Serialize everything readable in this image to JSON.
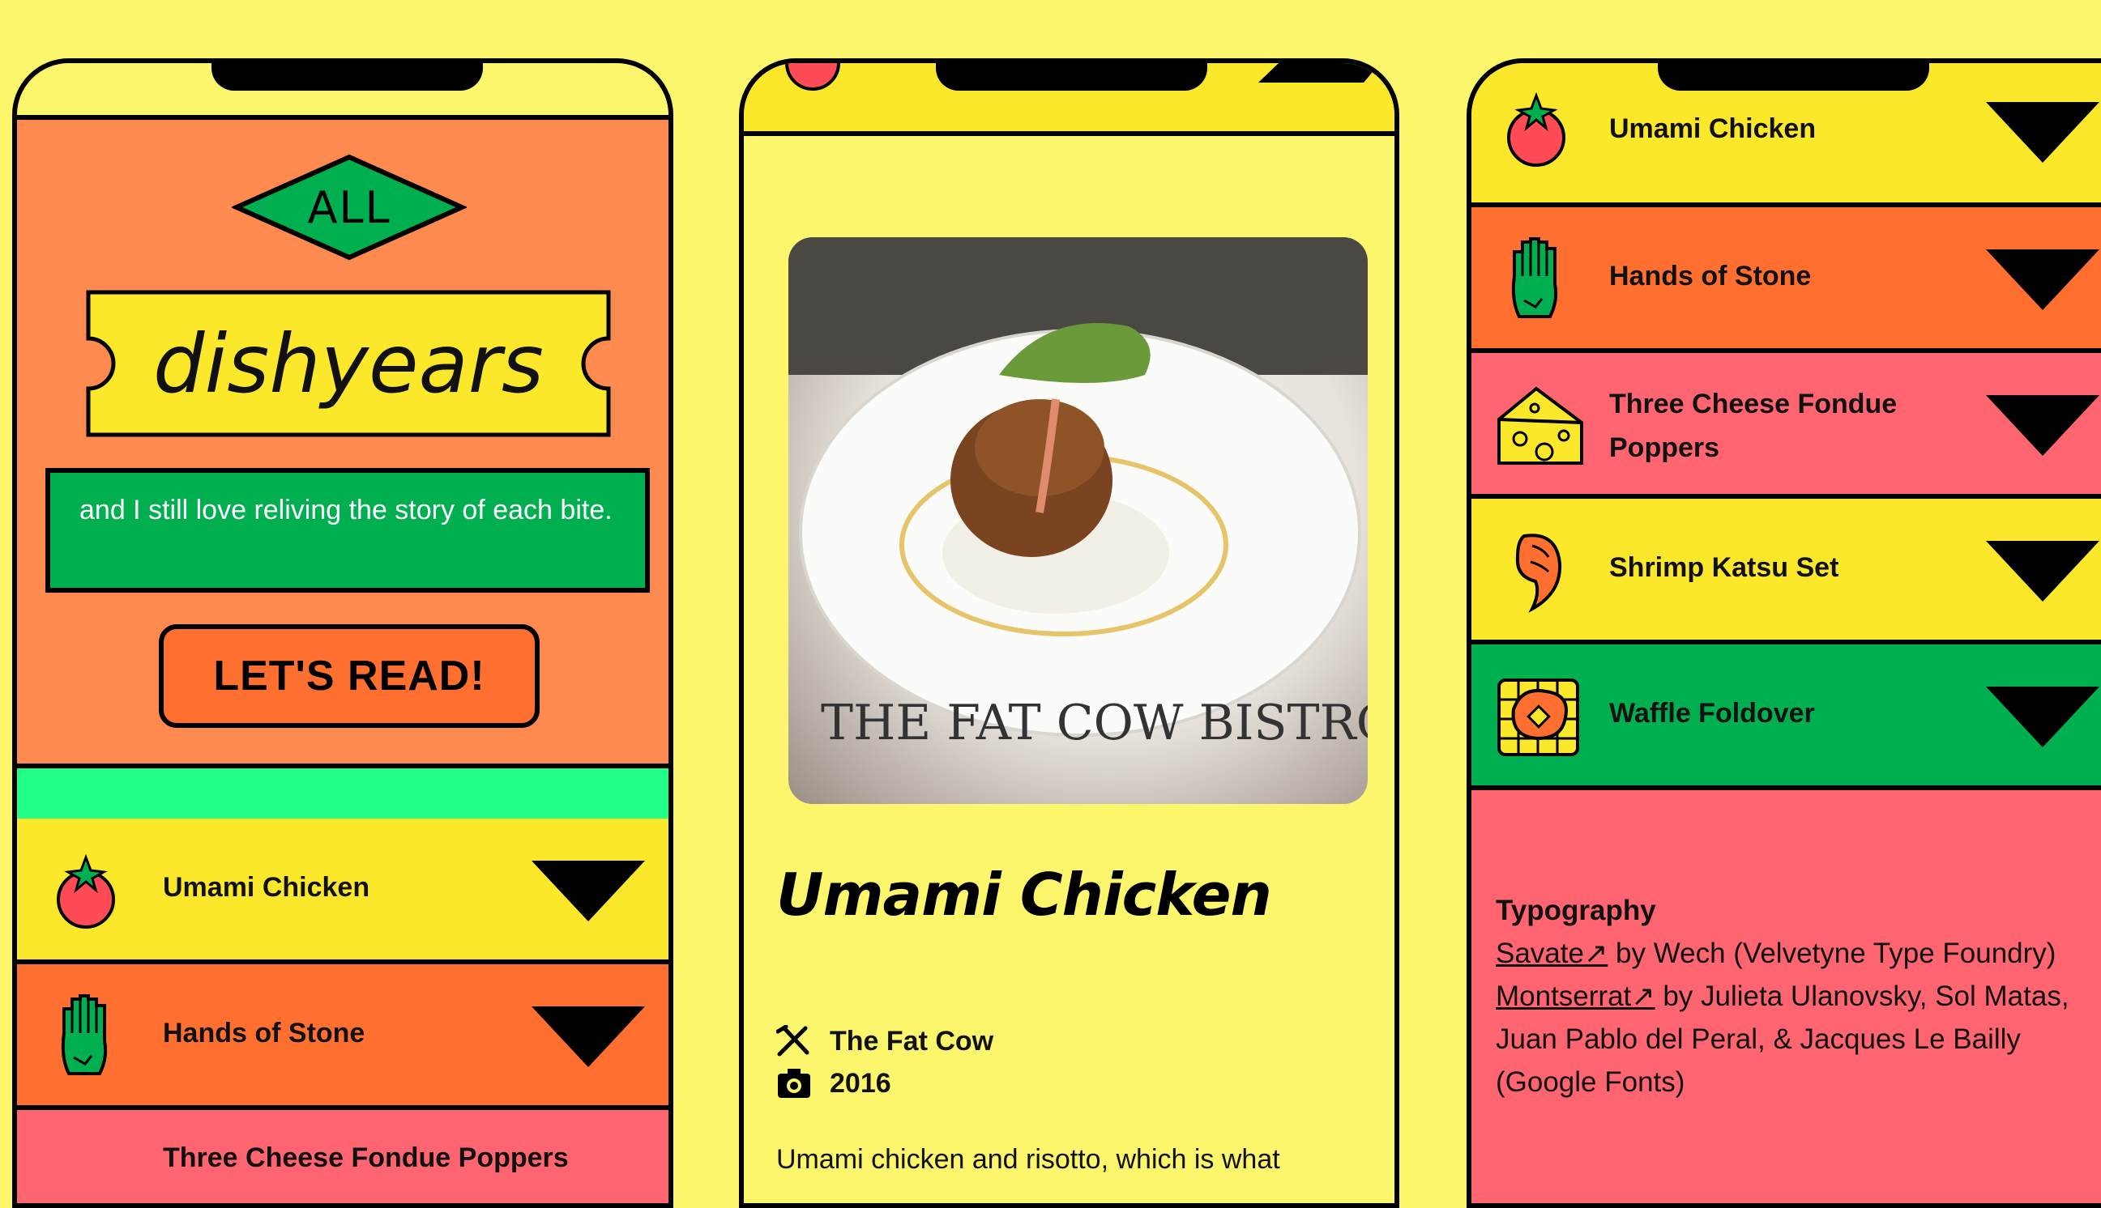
{
  "landing": {
    "filter_label": "ALL",
    "brand": "dishyears",
    "tagline": "and I still love reliving the story of each bite.",
    "cta": "LET'S READ!"
  },
  "dishes": [
    {
      "name": "Umami Chicken",
      "icon": "tomato-icon",
      "color": "#fbe82a"
    },
    {
      "name": "Hands of Stone",
      "icon": "glove-icon",
      "color": "#ff6f30"
    },
    {
      "name": "Three Cheese Fondue Poppers",
      "icon": "cheese-icon",
      "color": "#ff6570"
    },
    {
      "name": "Shrimp Katsu Set",
      "icon": "shrimp-icon",
      "color": "#fbe82a"
    },
    {
      "name": "Waffle Foldover",
      "icon": "waffle-icon",
      "color": "#00b050"
    }
  ],
  "detail": {
    "title": "Umami Chicken",
    "restaurant": "The Fat Cow",
    "year": "2016",
    "photo_caption": "THE FAT COW BISTRO",
    "body_preview": "Umami chicken and risotto, which is what"
  },
  "credits": {
    "heading": "Typography",
    "font1_name": "Savate↗",
    "font1_by": " by Wech (Velvetyne Type Foundry)",
    "font2_name": "Montserrat↗",
    "font2_by": " by Julieta Ulanovsky, Sol Matas, Juan Pablo del Peral, & Jacques Le Bailly (Google Fonts)"
  }
}
